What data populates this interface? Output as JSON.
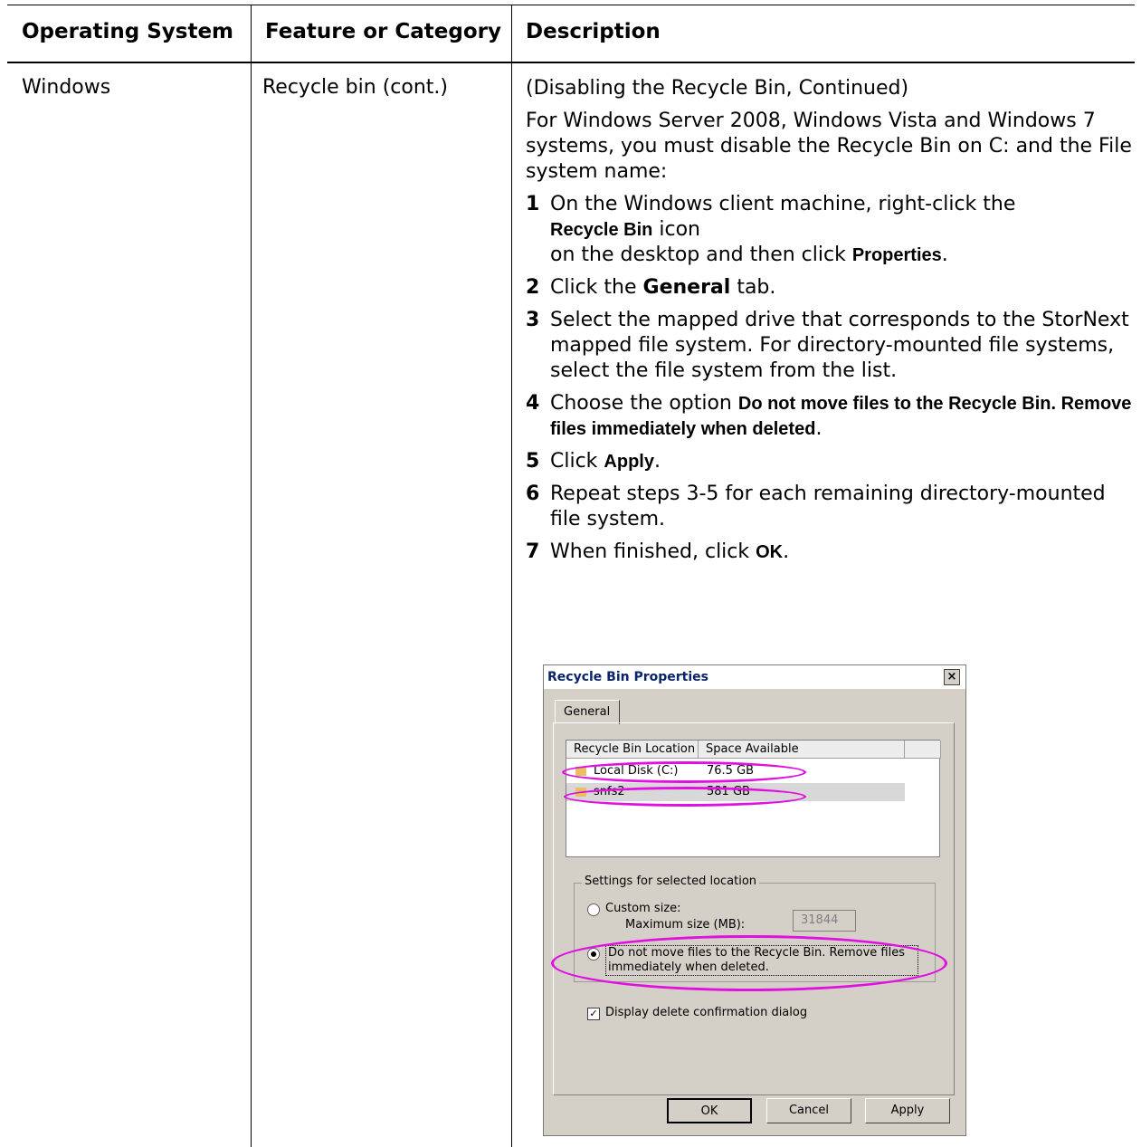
{
  "table": {
    "headers": [
      "Operating System",
      "Feature or Category",
      "Description"
    ],
    "os": "Windows",
    "feature": "Recycle bin (cont.)"
  },
  "description": {
    "para1": "(Disabling the Recycle Bin, Continued)",
    "para2": "For Windows Server 2008, Windows Vista and Windows 7 systems, you must disable the Recycle Bin on C: and the File system name:",
    "step1": {
      "num": "1",
      "a": "On the Windows client machine, right-click the",
      "b": "Recycle Bin",
      "c": " icon",
      "d": "on the desktop and then click ",
      "e": "Properties",
      "f": "."
    },
    "step2": {
      "num": "2",
      "a": "Click the ",
      "b": "General",
      "c": " tab."
    },
    "step3": {
      "num": "3",
      "a": "Select the mapped drive that corresponds to the StorNext mapped file system. For directory-mounted file systems, select the file system from the list."
    },
    "step4": {
      "num": "4",
      "a": "Choose the option ",
      "b": "Do not move files to the Recycle Bin. Remove files immediately when deleted",
      "c": "."
    },
    "step5": {
      "num": "5",
      "a": "Click ",
      "b": "Apply",
      "c": "."
    },
    "step6": {
      "num": "6",
      "a": "Repeat steps 3-5 for each remaining directory-mounted file system."
    },
    "step7": {
      "num": "7",
      "a": "When finished, click ",
      "b": "OK",
      "c": "."
    }
  },
  "dialog": {
    "title": "Recycle Bin Properties",
    "close": "×",
    "tab": "General",
    "columns": [
      "Recycle Bin Location",
      "Space Available"
    ],
    "rows": [
      {
        "name": "Local Disk (C:)",
        "space": "76.5 GB"
      },
      {
        "name": "snfs2",
        "space": "581 GB"
      }
    ],
    "group_label": "Settings for selected location",
    "custom_size": "Custom size:",
    "max_size": "Maximum size (MB):",
    "max_value": "31844",
    "do_not_move": "Do not move files to the Recycle Bin. Remove files immediately when deleted.",
    "display_confirm": "Display delete confirmation dialog",
    "check_mark": "✓",
    "ok": "OK",
    "cancel": "Cancel",
    "apply": "Apply",
    "highlight_color": "#e010e0"
  }
}
